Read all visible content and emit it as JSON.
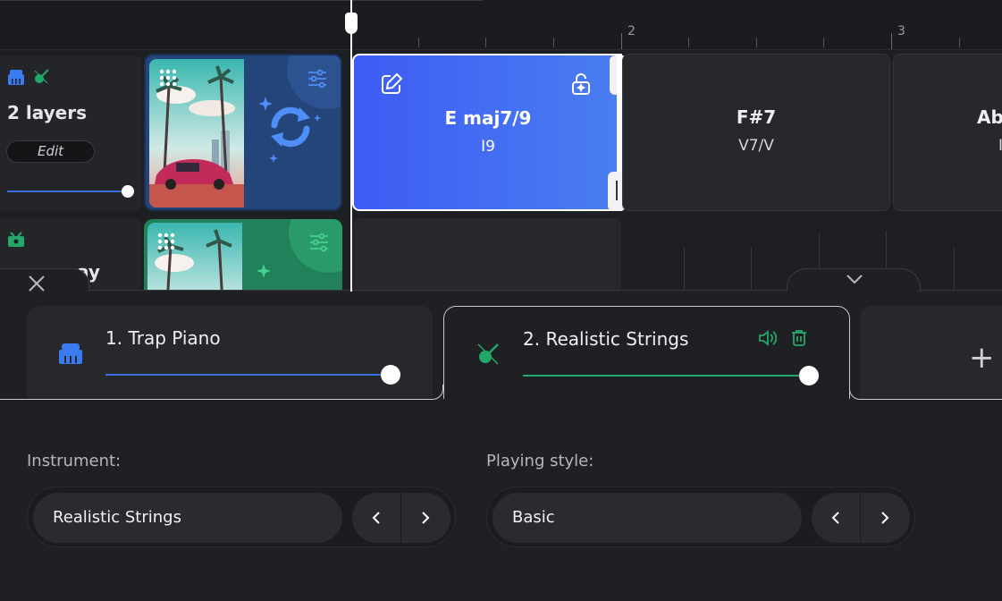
{
  "ruler": {
    "bar_numbers": [
      "2",
      "3"
    ]
  },
  "tracks": [
    {
      "layers_label": "2 layers",
      "edit_label": "Edit",
      "volume": 1.0
    },
    {
      "label_fragment": "ay"
    }
  ],
  "chords": [
    {
      "name": "E maj7/9",
      "roman": "I9",
      "active": true
    },
    {
      "name": "F#7",
      "roman": "V7/V",
      "active": false
    },
    {
      "name": "Ab",
      "roman": "I",
      "active": false
    }
  ],
  "layers": [
    {
      "title": "1. Trap Piano",
      "color": "#3a6fe0",
      "volume": 1.0
    },
    {
      "title": "2. Realistic Strings",
      "color": "#22a86a",
      "volume": 1.0
    }
  ],
  "add_layer_label": "+",
  "instrument": {
    "label": "Instrument:",
    "value": "Realistic Strings"
  },
  "playing_style": {
    "label": "Playing style:",
    "value": "Basic"
  },
  "colors": {
    "accent_blue": "#3d5cf5",
    "accent_green": "#22a86a"
  }
}
